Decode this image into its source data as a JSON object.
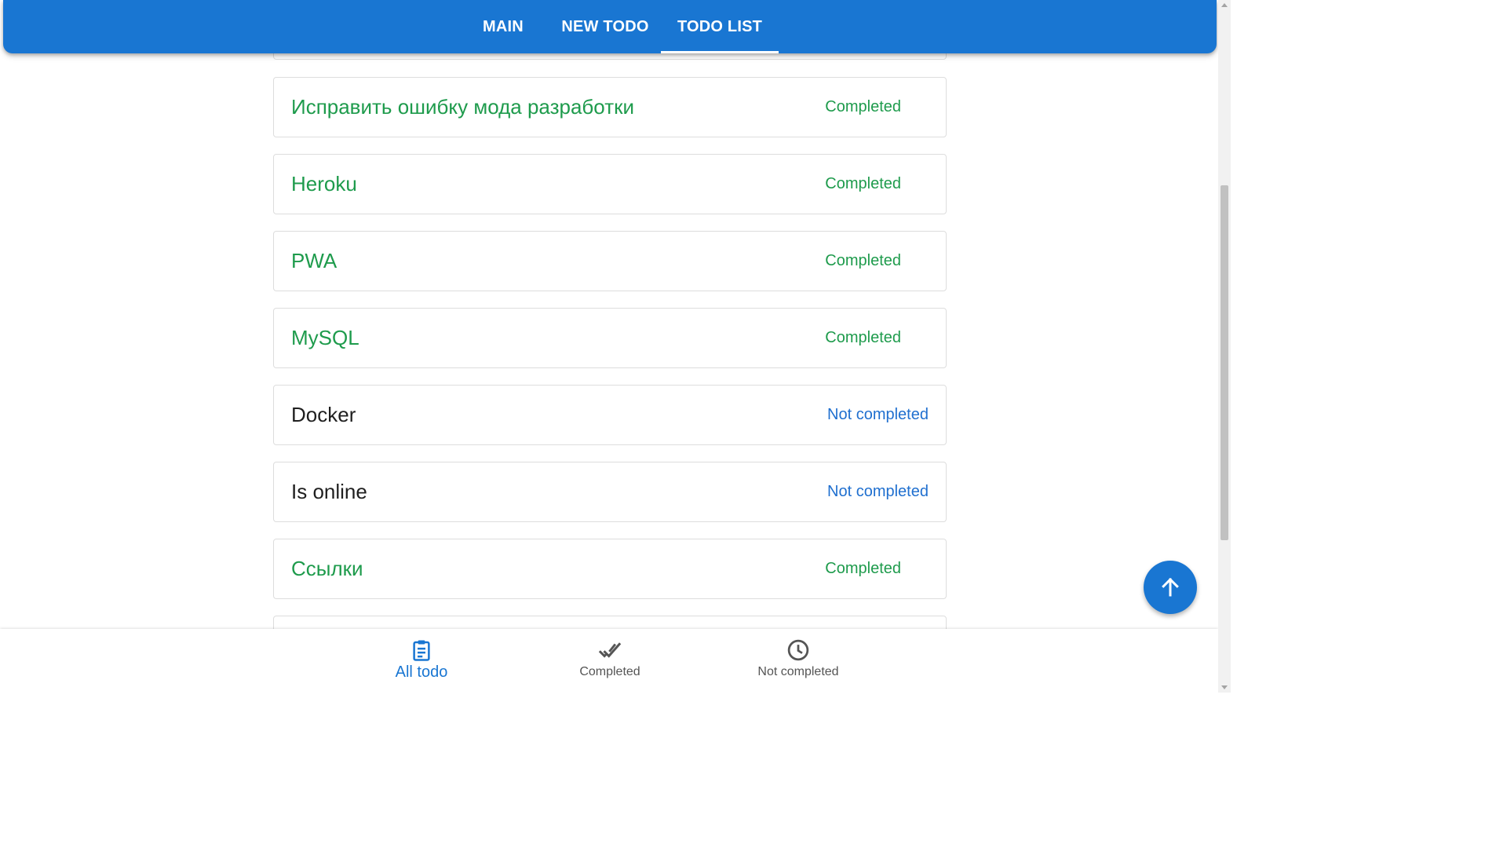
{
  "tabs": [
    {
      "label": "MAIN"
    },
    {
      "label": "NEW TODO"
    },
    {
      "label": "TODO LIST",
      "active": true
    }
  ],
  "todos": [
    {
      "title": "",
      "status": "",
      "state": "done"
    },
    {
      "title": "Исправить ошибку мода разработки",
      "status": "Completed",
      "state": "done"
    },
    {
      "title": "Heroku",
      "status": "Completed",
      "state": "done"
    },
    {
      "title": "PWA",
      "status": "Completed",
      "state": "done"
    },
    {
      "title": "MySQL",
      "status": "Completed",
      "state": "done"
    },
    {
      "title": "Docker",
      "status": "Not completed",
      "state": "open"
    },
    {
      "title": "Is online",
      "status": "Not completed",
      "state": "open"
    },
    {
      "title": "Ссылки",
      "status": "Completed",
      "state": "done"
    },
    {
      "title": "",
      "status": "",
      "state": "done"
    }
  ],
  "bottom_nav": {
    "all": {
      "label": "All todo",
      "icon": "clipboard-list-icon",
      "active": true
    },
    "completed": {
      "label": "Completed",
      "icon": "double-check-icon"
    },
    "not_completed": {
      "label": "Not completed",
      "icon": "clock-icon"
    }
  },
  "fab": {
    "icon": "arrow-up-icon"
  },
  "colors": {
    "primary": "#1976d2",
    "completed": "#1e9b4c",
    "not_completed": "#1f6fcf"
  }
}
